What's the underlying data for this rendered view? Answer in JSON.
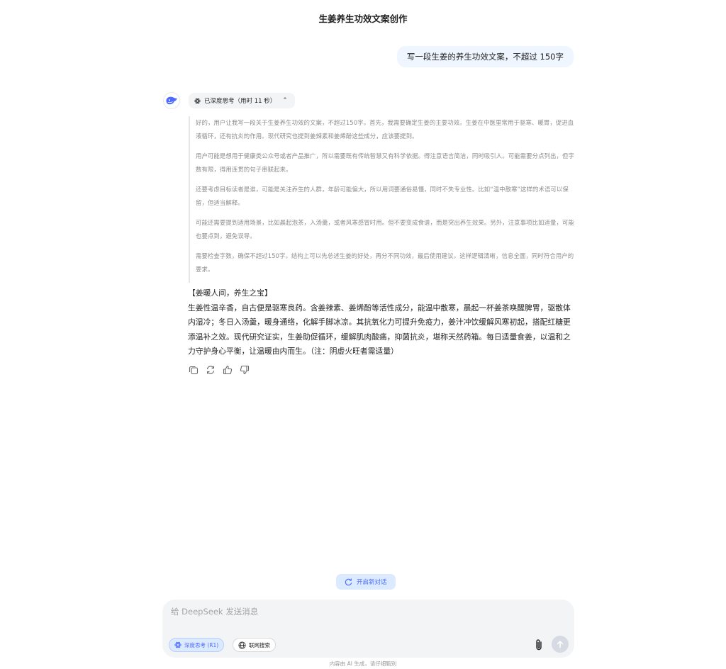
{
  "header": {
    "title": "生姜养生功效文案创作"
  },
  "conversation": {
    "user_message": "写一段生姜的养生功效文案，不超过 150字",
    "assistant": {
      "thinking_label": "已深度思考（用时 11 秒）",
      "thinking_paragraphs": [
        "好的，用户让我写一段关于生姜养生功效的文案，不超过150字。首先，我需要确定生姜的主要功效。生姜在中医里常用于驱寒、暖胃，促进血液循环，还有抗炎的作用。现代研究也提到姜辣素和姜烯酚这些成分，应该要提到。",
        "用户可能是想用于健康类公众号或者产品推广，所以需要既有传统智慧又有科学依据。得注意语言简洁，同时吸引人。可能需要分点列出，但字数有限，得用连贯的句子串联起来。",
        "还要考虑目标读者是谁，可能是关注养生的人群，年龄可能偏大，所以用词要通俗易懂，同时不失专业性。比如“温中散寒”这样的术语可以保留，但适当解释。",
        "可能还需要提到适用场景，比如晨起泡茶，入汤羹，或者风寒感冒时用。但不要变成食谱，而是突出养生效果。另外，注意事项比如适量，可能也要点到，避免误导。",
        "需要检查字数，确保不超过150字。结构上可以先总述生姜的好处，再分不同功效，最后使用建议。这样逻辑清晰，信息全面，同时符合用户的要求。"
      ],
      "answer_title": "【姜暖人间，养生之宝】",
      "answer_body": "生姜性温辛香，自古便是驱寒良药。含姜辣素、姜烯酚等活性成分，能温中散寒，晨起一杯姜茶唤醒脾胃，驱散体内湿冷；冬日入汤羹，暖身通络，化解手脚冰凉。其抗氧化力可提升免疫力，姜汁冲饮缓解风寒初起，搭配红糖更添温补之效。现代研究证实，生姜助促循环，缓解肌肉酸痛，抑菌抗炎，堪称天然药箱。每日适量食姜，以温和之力守护身心平衡，让温暖由内而生。（注：阴虚火旺者需适量）"
    }
  },
  "new_chat_label": "开启新对话",
  "composer": {
    "placeholder": "给 DeepSeek 发送消息",
    "deep_think_label": "深度思考 (R1)",
    "web_search_label": "联网搜索"
  },
  "footer": {
    "disclaimer": "内容由 AI 生成，请仔细甄别"
  },
  "colors": {
    "accent": "#4d6bfe",
    "bubble": "#eff6ff",
    "chip_bg": "#dbeafe"
  }
}
